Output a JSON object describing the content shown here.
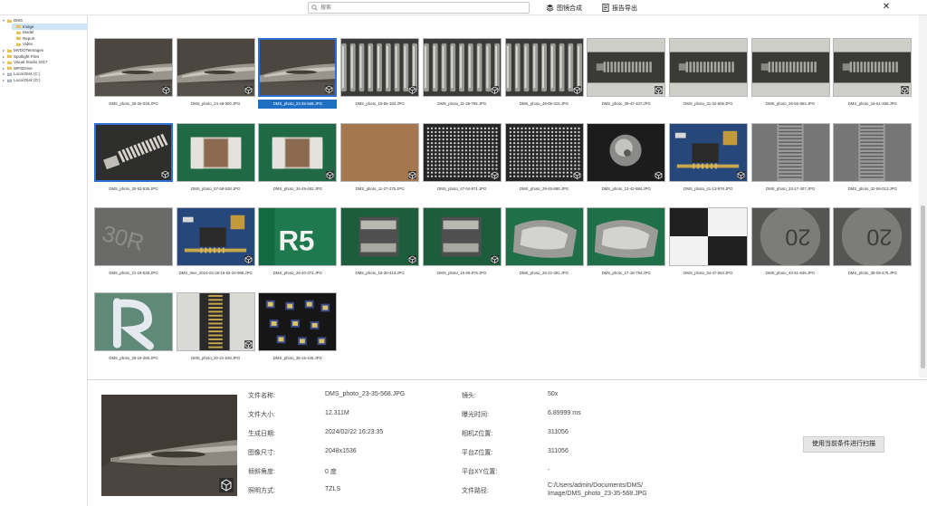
{
  "toolbar": {
    "search_placeholder": "搜索",
    "merge_label": "图镜合成",
    "export_label": "报告导出",
    "close_glyph": "✕"
  },
  "sidebar": {
    "items": [
      {
        "label": "DMS",
        "level": 0,
        "expand": "▾"
      },
      {
        "label": "Image",
        "level": 1,
        "expand": "",
        "selected": true
      },
      {
        "label": "Model",
        "level": 1,
        "expand": ""
      },
      {
        "label": "Report",
        "level": 1,
        "expand": ""
      },
      {
        "label": "Video",
        "level": 1,
        "expand": ""
      },
      {
        "label": "MVDOTeImages",
        "level": 0,
        "expand": "▸"
      },
      {
        "label": "Spotlight Files",
        "level": 0,
        "expand": "▸"
      },
      {
        "label": "Visual Studio 2017",
        "level": 0,
        "expand": "▸"
      },
      {
        "label": "WPSDrive",
        "level": 0,
        "expand": "▸"
      },
      {
        "label": "Local Disk (C:)",
        "level": 0,
        "expand": "▸",
        "drive": true
      },
      {
        "label": "Local Disk (D:)",
        "level": 0,
        "expand": "▸",
        "drive": true
      }
    ]
  },
  "thumbnails": [
    {
      "caption": "DMS_photo_28-25-048.JPG",
      "kind": "needle",
      "cube": true
    },
    {
      "caption": "DMS_photo_24-48-900.JPG",
      "kind": "needle",
      "cube": true
    },
    {
      "caption": "DMS_photo_23-35-568.JPG",
      "kind": "needle",
      "cube": true,
      "selected": true
    },
    {
      "caption": "DMS_photo_15-55-184.JPG",
      "kind": "spring",
      "cube": true
    },
    {
      "caption": "DMS_photo_11-29-755.JPG",
      "kind": "spring",
      "cube": true
    },
    {
      "caption": "DMS_photo_49-09-310.JPG",
      "kind": "spring",
      "cube": true
    },
    {
      "caption": "DMS_photo_39-47-407.JPG",
      "kind": "coil",
      "cube": true
    },
    {
      "caption": "DMS_photo_31-32-605.JPG",
      "kind": "coil",
      "cube": false
    },
    {
      "caption": "DMS_photo_26-55-863.JPG",
      "kind": "coil",
      "cube": false
    },
    {
      "caption": "DMS_photo_16-51-365.JPG",
      "kind": "coil",
      "cube": true
    },
    {
      "caption": "DMS_photo_20-53-539.JPG",
      "kind": "springcolor",
      "cube": true,
      "selected_border": true
    },
    {
      "caption": "DMS_photo_57-58-528.JPG",
      "kind": "resistor",
      "cube": false
    },
    {
      "caption": "DMS_photo_34-49-462.JPG",
      "kind": "resistor",
      "cube": true
    },
    {
      "caption": "DMS_photo_11-27-275.JPG",
      "kind": "brown",
      "cube": true
    },
    {
      "caption": "DMS_photo_47-04-971.JPG",
      "kind": "bga",
      "cube": true
    },
    {
      "caption": "DMS_photo_29-45-880.JPG",
      "kind": "bga",
      "cube": true
    },
    {
      "caption": "DMS_photo_13-42-884.JPG",
      "kind": "ball",
      "cube": true
    },
    {
      "caption": "DMS_photo_41-13-978.JPG",
      "kind": "pcbblue",
      "cube": true
    },
    {
      "caption": "DMS_photo_33-17-407.JPG",
      "kind": "ridge",
      "cube": false
    },
    {
      "caption": "DMS_photo_32-56-013.JPG",
      "kind": "ridge",
      "cube": false
    },
    {
      "caption": "DMS_photo_21-18-538.JPG",
      "kind": "chipgray",
      "cube": false
    },
    {
      "caption": "DMS_time_2024-02-28-16-52-20-968.JPG",
      "kind": "pcbblue",
      "cube": true
    },
    {
      "caption": "DMS_photo_28-40-373.JPG",
      "kind": "r5",
      "cube": false
    },
    {
      "caption": "DMS_photo_18-30-413.JPG",
      "kind": "greenchip",
      "cube": true
    },
    {
      "caption": "DMS_photo_15-55-875.JPG",
      "kind": "greenchip",
      "cube": true
    },
    {
      "caption": "DMS_photo_26-22-491.JPG",
      "kind": "solder",
      "cube": false
    },
    {
      "caption": "DMS_photo_17-18-794.JPG",
      "kind": "solder",
      "cube": false
    },
    {
      "caption": "DMS_photo_34-47-663.JPG",
      "kind": "checker",
      "cube": false
    },
    {
      "caption": "DMS_photo_40-51-846.JPG",
      "kind": "coin",
      "cube": false
    },
    {
      "caption": "DMS_photo_38-09-478.JPG",
      "kind": "coin",
      "cube": false
    },
    {
      "caption": "DMS_photo_25-18-268.JPG",
      "kind": "letterR",
      "cube": false
    },
    {
      "caption": "DMS_photo_20-21-528.JPG",
      "kind": "connector",
      "cube": true
    },
    {
      "caption": "DMS_photo_35-15-445.JPG",
      "kind": "chips",
      "cube": false
    }
  ],
  "details": {
    "col1": [
      {
        "label": "文件名称:",
        "value": "DMS_photo_23-35-568.JPG"
      },
      {
        "label": "文件大小:",
        "value": "12.311M"
      },
      {
        "label": "生成日期:",
        "value": "2024/02/22 16:23:35"
      },
      {
        "label": "图像尺寸:",
        "value": "2048x1536"
      },
      {
        "label": "倾斜角度:",
        "value": "0 度"
      },
      {
        "label": "照明方式:",
        "value": "TZLS"
      }
    ],
    "col2": [
      {
        "label": "镜头:",
        "value": "50x"
      },
      {
        "label": "曝光时间:",
        "value": "6.89999 ms"
      },
      {
        "label": "相机Z位置:",
        "value": "311056"
      },
      {
        "label": "平台Z位置:",
        "value": "311056"
      },
      {
        "label": "平台XY位置:",
        "value": "-"
      },
      {
        "label": "文件路径:",
        "value": "C:/Users/admin/Documents/DMS/",
        "value2": "Image/DMS_photo_23-35-568.JPG"
      }
    ],
    "scan_button": "使用当前条件进行扫描"
  }
}
